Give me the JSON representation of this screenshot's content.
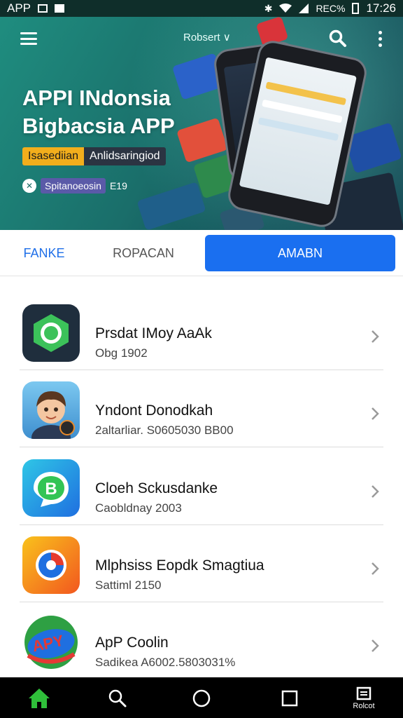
{
  "status_bar": {
    "left_text": "APP",
    "right_text": "REC%",
    "time": "17:26"
  },
  "hero": {
    "top_label": "Robsert ∨",
    "title_line1": "APPI INdonsia",
    "title_line2": "Bigbacsia APP",
    "tag_yellow": "Isasediian",
    "tag_dark": "Anlidsaringiod",
    "sub_text": "Spitanoeosin",
    "sub_number": "E19"
  },
  "tabs": [
    {
      "label": "FANKE"
    },
    {
      "label": "ROPACAN"
    },
    {
      "label": "AMABN",
      "active": true
    }
  ],
  "apps": [
    {
      "name": "Prsdat IMoy AaAk",
      "meta": "Obg 1902"
    },
    {
      "name": "Yndont Donodkah",
      "meta": "2altarliar. S0605030 BB00"
    },
    {
      "name": "Cloeh Sckusdanke",
      "meta": "Caobldnay 2003"
    },
    {
      "name": "Mlphsiss Eopdk Smagtiua",
      "meta": "Sattiml 2150"
    },
    {
      "name": "ApP Coolin",
      "meta": "Sadikea A6002.5803031%"
    }
  ],
  "app_icon_badges": [
    "",
    "",
    "",
    "",
    "APY"
  ],
  "nav_bar": {
    "recent_label": "Rolcot"
  },
  "colors": {
    "accent": "#1a6ff0",
    "hero_start": "#1f8d7f",
    "hero_end": "#0f3c4a",
    "tag_yellow": "#f2ae1c",
    "nav_home": "#2fbf3a"
  },
  "icons": [
    "menu-icon",
    "search-icon",
    "more-icon",
    "chevron-right-icon",
    "home-icon",
    "circle-icon",
    "square-icon",
    "recent-icon"
  ]
}
